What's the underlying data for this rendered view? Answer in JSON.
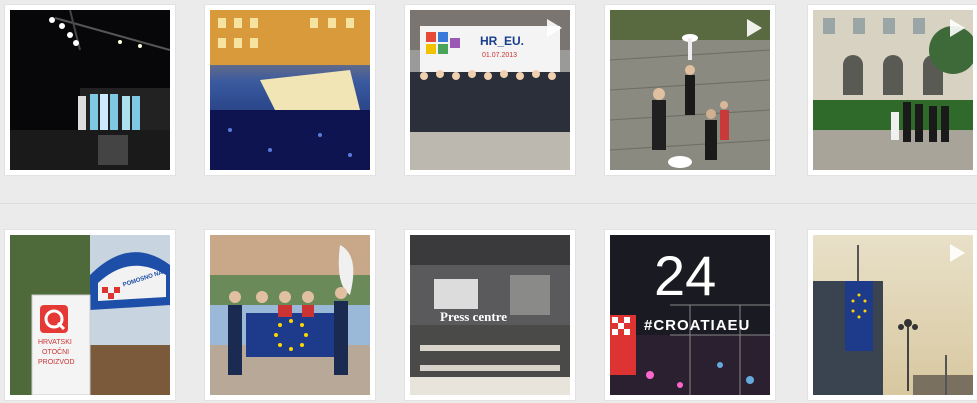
{
  "grid": {
    "rows": [
      [
        {
          "id": "p1",
          "label": "concert-stage-photo",
          "video": false
        },
        {
          "id": "p2",
          "label": "night-square-crowd-photo",
          "video": false
        },
        {
          "id": "p3",
          "label": "leaders-group-photo",
          "video": true,
          "sign_title": "HR_EU.",
          "sign_date": "01.07.2013"
        },
        {
          "id": "p4",
          "label": "courtyard-reception-photo",
          "video": true
        },
        {
          "id": "p5",
          "label": "garden-arrival-photo",
          "video": true
        }
      ],
      [
        {
          "id": "p6",
          "label": "product-stand-photo",
          "video": false,
          "banner_text": "POMOSNO NAŠE",
          "sign_lines": [
            "HRVATSKI",
            "OTOČNI",
            "PROIZVOD"
          ]
        },
        {
          "id": "p7",
          "label": "eu-flag-group-photo",
          "video": false
        },
        {
          "id": "p8",
          "label": "press-centre-photo",
          "video": false,
          "caption": "Press centre"
        },
        {
          "id": "p9",
          "label": "croatiaeu-countdown-photo",
          "video": false,
          "number": "24",
          "hashtag": "#CROATIAEU"
        },
        {
          "id": "p10",
          "label": "flag-rooftop-photo",
          "video": true
        }
      ]
    ]
  },
  "colors": {
    "page_bg": "#ebebeb",
    "tile_bg": "#ffffff",
    "eu_blue": "#1e3a8a"
  }
}
